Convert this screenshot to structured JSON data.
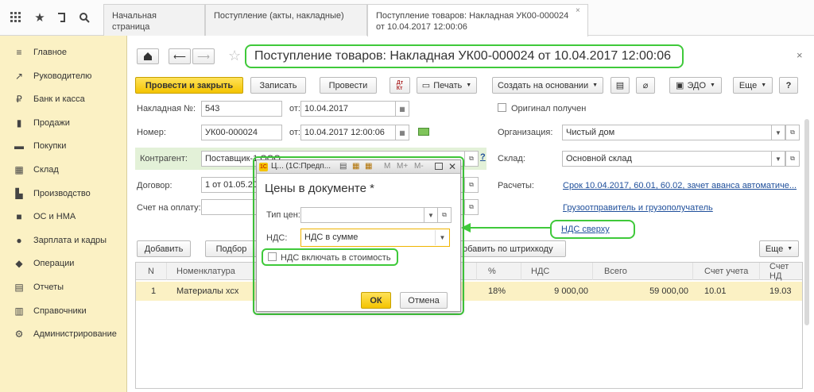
{
  "tabs": [
    "Начальная страница",
    "Поступление (акты, накладные)",
    "Поступление товаров: Накладная УК00-000024 от 10.04.2017 12:00:06"
  ],
  "top_icons": [
    "apps-grid-icon",
    "star-icon",
    "history-icon",
    "search-icon"
  ],
  "sidebar": [
    {
      "icon": "chart-icon",
      "glyph": "≡",
      "label": "Главное"
    },
    {
      "icon": "trend-icon",
      "glyph": "↗",
      "label": "Руководителю"
    },
    {
      "icon": "ruble-icon",
      "glyph": "₽",
      "label": "Банк и касса"
    },
    {
      "icon": "bag-icon",
      "glyph": "▮",
      "label": "Продажи"
    },
    {
      "icon": "cart-icon",
      "glyph": "▬",
      "label": "Покупки"
    },
    {
      "icon": "warehouse-icon",
      "glyph": "▦",
      "label": "Склад"
    },
    {
      "icon": "factory-icon",
      "glyph": "▙",
      "label": "Производство"
    },
    {
      "icon": "truck-icon",
      "glyph": "■",
      "label": "ОС и НМА"
    },
    {
      "icon": "person-icon",
      "glyph": "●",
      "label": "Зарплата и кадры"
    },
    {
      "icon": "operations-icon",
      "glyph": "◆",
      "label": "Операции"
    },
    {
      "icon": "reports-icon",
      "glyph": "▤",
      "label": "Отчеты"
    },
    {
      "icon": "books-icon",
      "glyph": "▥",
      "label": "Справочники"
    },
    {
      "icon": "gear-icon",
      "glyph": "⚙",
      "label": "Администрирование"
    }
  ],
  "doc": {
    "title": "Поступление товаров: Накладная УК00-000024 от 10.04.2017 12:00:06",
    "toolbar": {
      "post_close": "Провести и закрыть",
      "save": "Записать",
      "post": "Провести",
      "print": "Печать",
      "create_based": "Создать на основании",
      "edo": "ЭДО",
      "more": "Еще",
      "help": "?"
    },
    "invoice_label": "Накладная №:",
    "invoice_no": "543",
    "from_label": "от:",
    "invoice_date": "10.04.2017",
    "number_label": "Номер:",
    "number": "УК00-000024",
    "number_date": "10.04.2017 12:00:06",
    "original_received": "Оригинал получен",
    "org_label": "Организация:",
    "org": "Чистый дом",
    "counterparty_label": "Контрагент:",
    "counterparty": "Поставщик-1 ООО",
    "warehouse_label": "Склад:",
    "warehouse": "Основной склад",
    "contract_label": "Договор:",
    "contract": "1 от 01.05.20",
    "payments_label": "Расчеты:",
    "payments_link": "Срок 10.04.2017, 60.01, 60.02, зачет аванса автоматиче...",
    "invoice_pay_label": "Счет на оплату:",
    "shipper_link": "Грузоотправитель и грузополучатель",
    "vat_link": "НДС сверху",
    "help_mark": "?"
  },
  "table": {
    "add": "Добавить",
    "pick": "Подбор",
    "barcode": "обавить по штрихкоду",
    "more": "Еще",
    "headers": [
      "N",
      "Номенклатура",
      "%",
      "НДС",
      "Всего",
      "Счет учета",
      "Счет НД"
    ],
    "rows": [
      {
        "n": "1",
        "name": "Материалы хсх",
        "pct": "18%",
        "vat": "9 000,00",
        "total": "59 000,00",
        "acc": "10.01",
        "acc2": "19.03"
      }
    ]
  },
  "dialog": {
    "window_title": "Ц... (1С:Предп...",
    "heading": "Цены в документе *",
    "price_type_label": "Тип цен:",
    "price_type": "",
    "vat_label": "НДС:",
    "vat_value": "НДС в сумме",
    "include_vat": "НДС включать в стоимость",
    "ok": "ОК",
    "cancel": "Отмена",
    "title_buttons": [
      "M",
      "M+",
      "M-"
    ]
  },
  "colors": {
    "accent_yellow": "#f4c400",
    "sidebar_bg": "#fbf1c4",
    "highlight_green": "#3fc93a",
    "link": "#1f4f9b"
  }
}
